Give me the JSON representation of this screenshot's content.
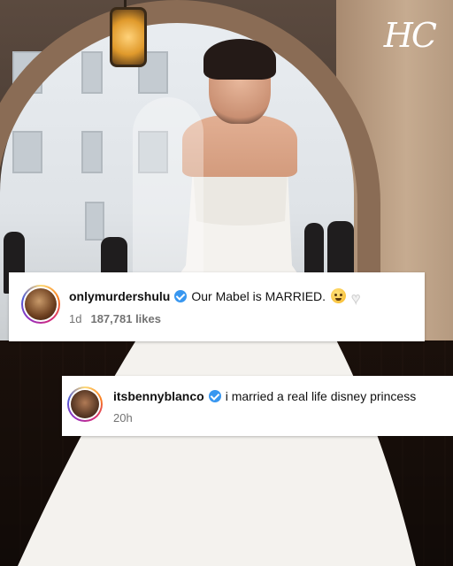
{
  "brand": {
    "logo_text": "HC"
  },
  "comments": [
    {
      "username": "onlymurdershulu",
      "verified": true,
      "text": "Our Mabel is MARRIED.",
      "emojis": [
        "pleading-face-icon",
        "white-heart-icon"
      ],
      "time": "1d",
      "likes": "187,781 likes"
    },
    {
      "username": "itsbennyblanco",
      "verified": true,
      "text": "i married a real life disney princess",
      "time": "20h"
    }
  ],
  "colors": {
    "verified_badge": "#3897f0",
    "card_background": "#ffffff",
    "meta_text": "#737373"
  }
}
